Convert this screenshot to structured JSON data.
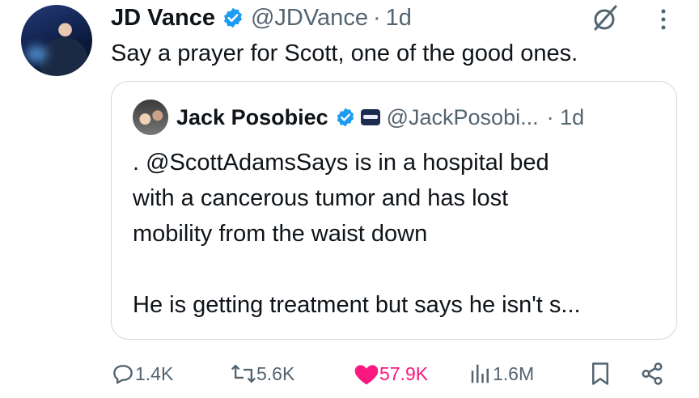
{
  "post": {
    "author": {
      "name": "JD Vance",
      "handle": "@JDVance",
      "time": "1d",
      "verified": true
    },
    "text": "Say a prayer for Scott, one of the good ones.",
    "quote": {
      "author": {
        "name": "Jack Posobiec",
        "handle": "@JackPosobi...",
        "time": "· 1d",
        "verified": true
      },
      "lines": [
        ". @ScottAdamsSays is in a hospital bed",
        "with a cancerous tumor and has lost",
        "mobility from the waist down",
        "",
        "He is getting treatment but says he isn't s..."
      ]
    },
    "metrics": {
      "replies": "1.4K",
      "reposts": "5.6K",
      "likes": "57.9K",
      "views": "1.6M"
    }
  },
  "icons": {
    "verified": "verified-badge-icon",
    "grok": "grok-icon",
    "more": "more-icon",
    "reply": "reply-icon",
    "repost": "repost-icon",
    "like": "heart-icon",
    "views": "views-icon",
    "bookmark": "bookmark-icon",
    "share": "share-icon"
  },
  "colors": {
    "text": "#0f1419",
    "muted": "#536471",
    "verified": "#1d9bf0",
    "like": "#f91880",
    "border": "#cfd9de"
  }
}
